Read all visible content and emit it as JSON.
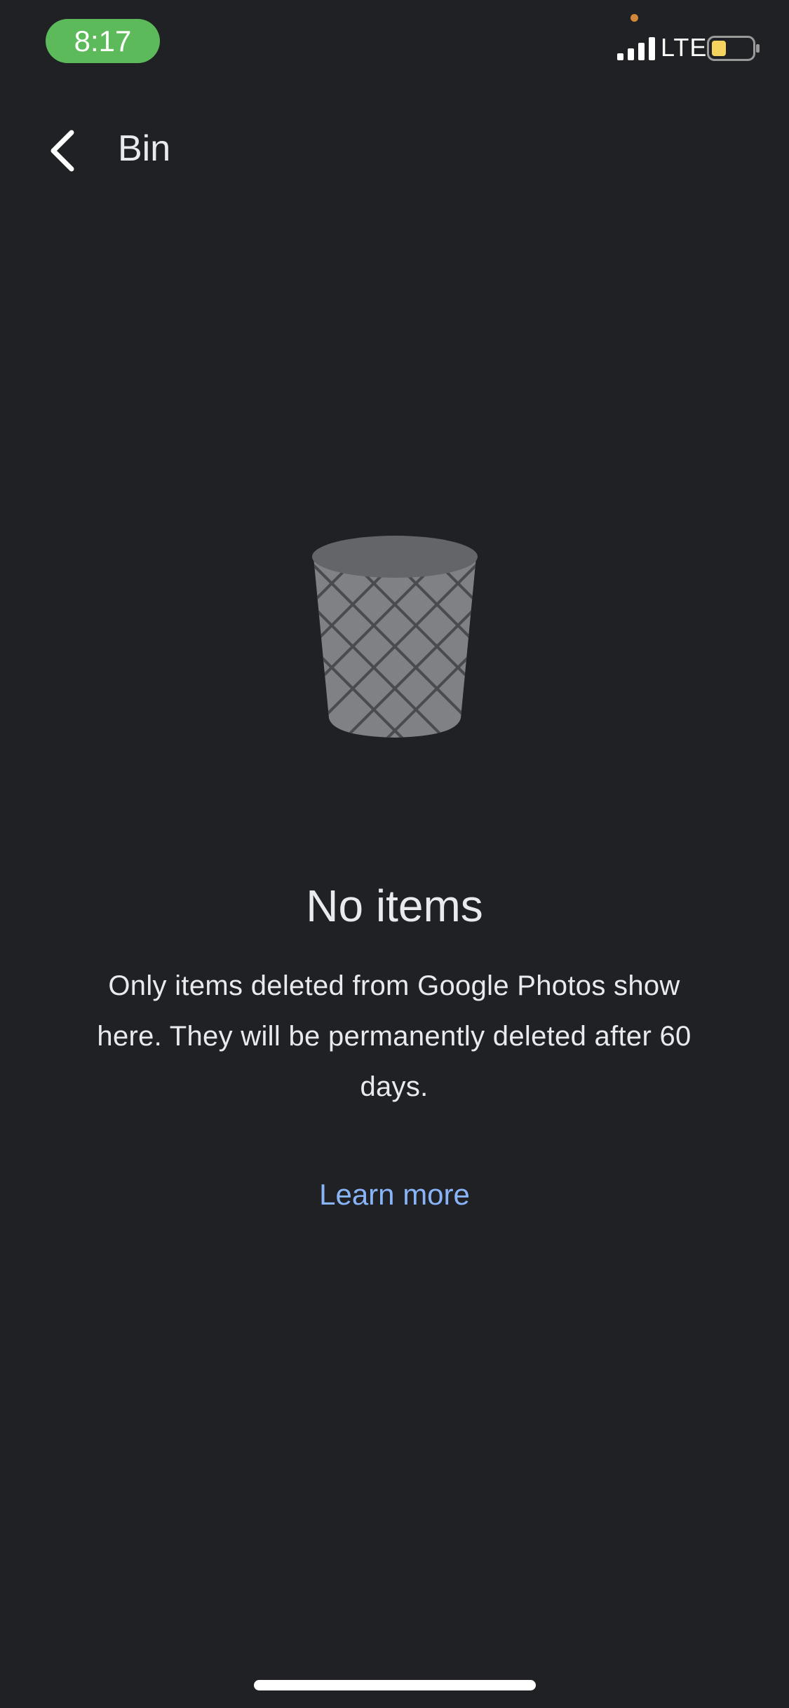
{
  "status_bar": {
    "time": "8:17",
    "network": "LTE",
    "icons": [
      "signal-icon",
      "battery-icon"
    ],
    "time_pill_color": "#5dba5a",
    "battery_color": "#f4d35e"
  },
  "app_bar": {
    "title": "Bin",
    "back_icon": "chevron-left-icon"
  },
  "empty_state": {
    "illustration": "trash-bin-icon",
    "title": "No items",
    "description": "Only items deleted from Google Photos show here. They will be permanently deleted after 60 days.",
    "link_label": "Learn more",
    "link_color": "#8ab4f8"
  },
  "theme": {
    "background": "#202124",
    "text": "#e8eaed"
  }
}
